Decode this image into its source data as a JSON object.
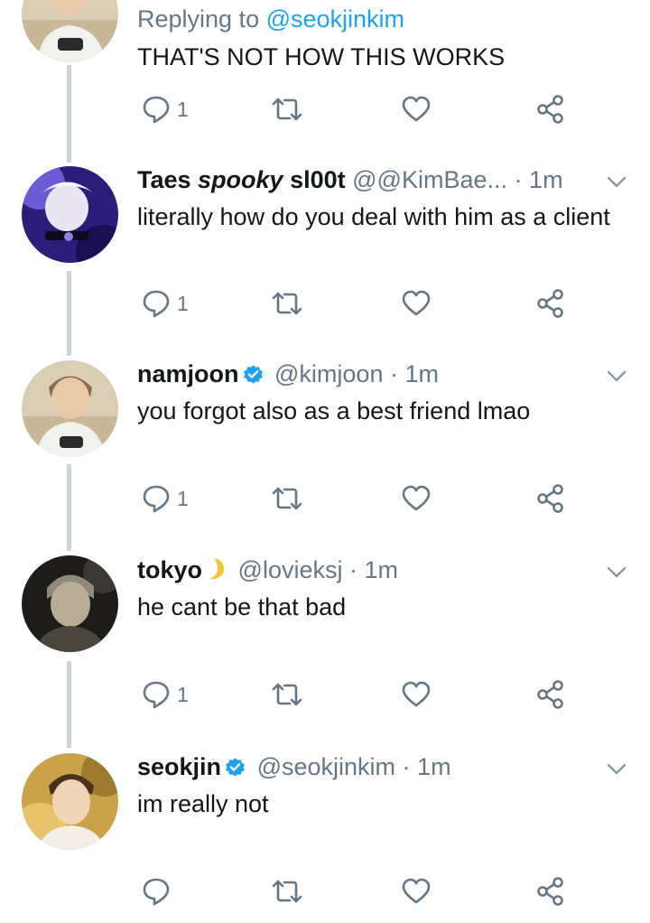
{
  "thread": [
    {
      "replying_prefix": "Replying to ",
      "replying_mention": "@seokjinkim",
      "text": "THAT'S NOT HOW THIS WORKS",
      "reply_count": "1"
    },
    {
      "name_pre": "Taes ",
      "name_em": "spooky",
      "name_post": " sl00t",
      "handle": "@@KimBae...",
      "time": "1m",
      "text": "literally how do you deal with him as a client",
      "reply_count": "1"
    },
    {
      "name": "namjoon",
      "verified": true,
      "handle": "@kimjoon",
      "time": "1m",
      "text": "you forgot also as a best friend lmao",
      "reply_count": "1"
    },
    {
      "name": "tokyo",
      "emoji": "crescent-moon",
      "handle": "@lovieksj",
      "time": "1m",
      "text": "he cant be that bad",
      "reply_count": "1"
    },
    {
      "name": "seokjin",
      "verified": true,
      "handle": "@seokjinkim",
      "time": "1m",
      "text": "im really not",
      "reply_count": ""
    }
  ],
  "separator": "·",
  "icons": [
    "reply-icon",
    "retweet-icon",
    "like-icon",
    "share-icon",
    "chevron-down-icon",
    "verified-badge-icon",
    "crescent-moon-emoji"
  ],
  "colors": {
    "text": "#14171a",
    "secondary": "#657786",
    "link": "#1da1f2",
    "verified": "#1da1f2",
    "thread_line": "#ccd6dd"
  }
}
